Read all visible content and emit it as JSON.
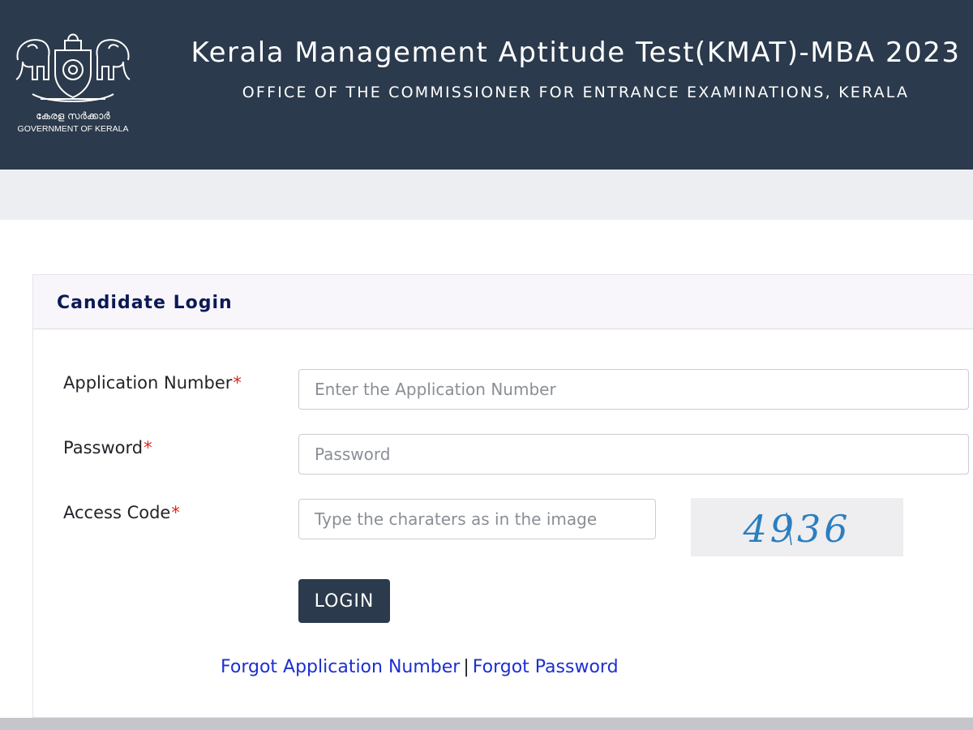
{
  "header": {
    "emblem": {
      "icon": "kerala-emblem-icon",
      "malayalam": "കേരള സർക്കാർ",
      "english": "GOVERNMENT OF KERALA"
    },
    "title": "Kerala Management Aptitude Test(KMAT)-MBA 2023",
    "subtitle": "OFFICE OF THE COMMISSIONER FOR ENTRANCE EXAMINATIONS, KERALA"
  },
  "login": {
    "title": "Candidate Login",
    "fields": {
      "application": {
        "label": "Application Number",
        "required_mark": "*",
        "placeholder": "Enter the Application Number",
        "value": ""
      },
      "password": {
        "label": "Password",
        "required_mark": "*",
        "placeholder": "Password",
        "value": ""
      },
      "access_code": {
        "label": "Access Code",
        "required_mark": "*",
        "placeholder": "Type the charaters as in the image",
        "value": ""
      }
    },
    "captcha": {
      "text": "4936",
      "color": "#2a7fc0"
    },
    "submit_label": "LOGIN",
    "links": {
      "forgot_application": "Forgot Application Number",
      "separator": "|",
      "forgot_password": "Forgot Password"
    }
  },
  "colors": {
    "header_bg": "#2b3a4c",
    "button_bg": "#2b3a4c",
    "link": "#1d2fd0",
    "required": "#e0231c",
    "card_title": "#0b1a55"
  }
}
